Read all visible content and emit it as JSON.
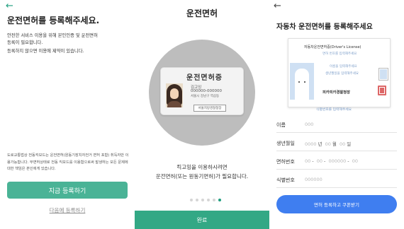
{
  "screen1": {
    "back_icon": "←",
    "title": "운전면허를 등록해주세요.",
    "desc_line1": "안전한 서비스 이용을 위해 본인인증 및 운전면허",
    "desc_line2": "등록이 필요합니다.",
    "desc_line3": "등록하지 않으면 이용에 제약이 있습니다.",
    "notice": "도로교통법상 전동킥보드는 운전면허(원동기장치자전거 면허 포함) 취득자만 이용가능합니다. 무면허상태로 전동 킥보드를 이용함으로써 발생하는 모든 문제에 대한 책임은 본인에게 있습니다.",
    "register_now": "지금 등록하기",
    "register_later": "다음에 등록하기",
    "accent_color": "#4ab396"
  },
  "screen2": {
    "title": "운전면허",
    "card": {
      "title": "운전면허증",
      "name": "김고잉",
      "number": "000000-000000",
      "address": "서울시 강남구 역삼동",
      "agency": "서울지방경찰청장"
    },
    "message_line1": "킥고잉을 이용하시려면",
    "message_line2": "운전면허(또는 원동기면허)가 필요합니다.",
    "page_indicator": {
      "total": 6,
      "active_index": 5
    },
    "done_button": "완료"
  },
  "screen3": {
    "back_icon": "←",
    "title": "자동차 운전면허를 등록해주세요",
    "license": {
      "heading": "자동차운전면허증(Driver's License)",
      "hint_number": "면허 번호를 입력해주세요",
      "hint_name": "이름을 입력해주세요",
      "hint_birth": "생년월일을 입력해주세요",
      "agency": "피카피카경찰청장",
      "hint_serial": "식별번호를 입력해주세요"
    },
    "fields": {
      "name_label": "이름",
      "name_value": "000",
      "birth_label": "생년월일",
      "birth_year": "0000",
      "birth_year_unit": "년",
      "birth_month": "00",
      "birth_month_unit": "월",
      "birth_day": "00",
      "birth_day_unit": "일",
      "license_label": "면허번호",
      "license_p1": "00",
      "license_p2": "00",
      "license_p3": "000000",
      "license_p4": "00",
      "dash": "-",
      "serial_label": "식별번호",
      "serial_value": "000000"
    },
    "submit_button": "면허 등록하고 쿠폰받기",
    "button_color": "#3f7ef0"
  }
}
